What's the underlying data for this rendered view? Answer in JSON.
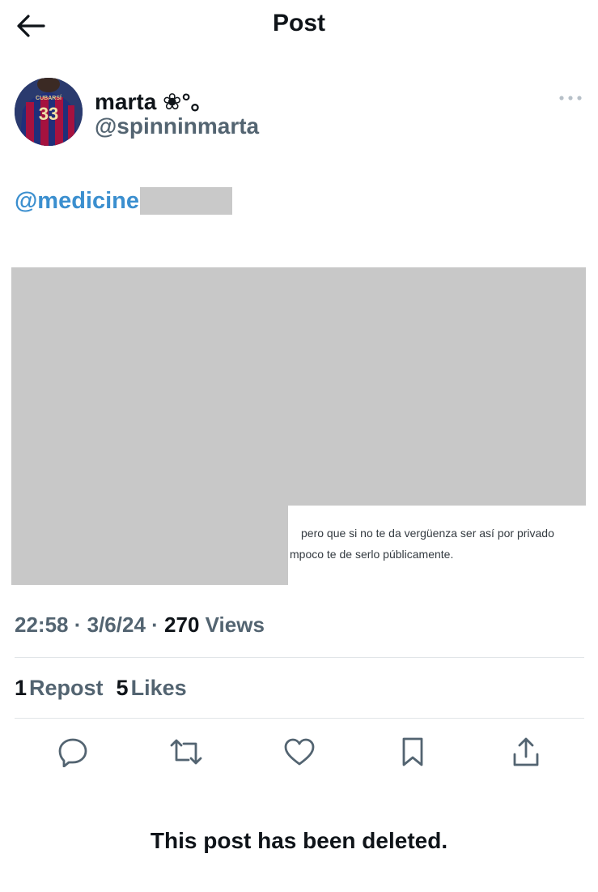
{
  "header": {
    "title": "Post",
    "back_icon": "arrow-left-icon"
  },
  "author": {
    "display_name": "marta ❀°｡",
    "handle": "@spinninmarta",
    "avatar_jersey_number": "33",
    "avatar_jersey_name": "CUBARSÍ"
  },
  "post": {
    "mention": "@medicine",
    "screenshot_lines": [
      "pero que si no te da vergüenza ser así por privado",
      "mpoco te de serlo públicamente."
    ]
  },
  "meta": {
    "time": "22:58",
    "date": "3/6/24",
    "views_count": "270",
    "views_label": "Views"
  },
  "stats": {
    "reposts_count": "1",
    "reposts_label": "Repost",
    "likes_count": "5",
    "likes_label": "Likes"
  },
  "actions": [
    "reply-icon",
    "repost-icon",
    "like-icon",
    "bookmark-icon",
    "share-icon"
  ],
  "deleted_message": "This post has been deleted.",
  "colors": {
    "link": "#3b8fcf",
    "secondary_text": "#536471",
    "primary_text": "#0f1419",
    "redaction": "#c8c8c8"
  }
}
